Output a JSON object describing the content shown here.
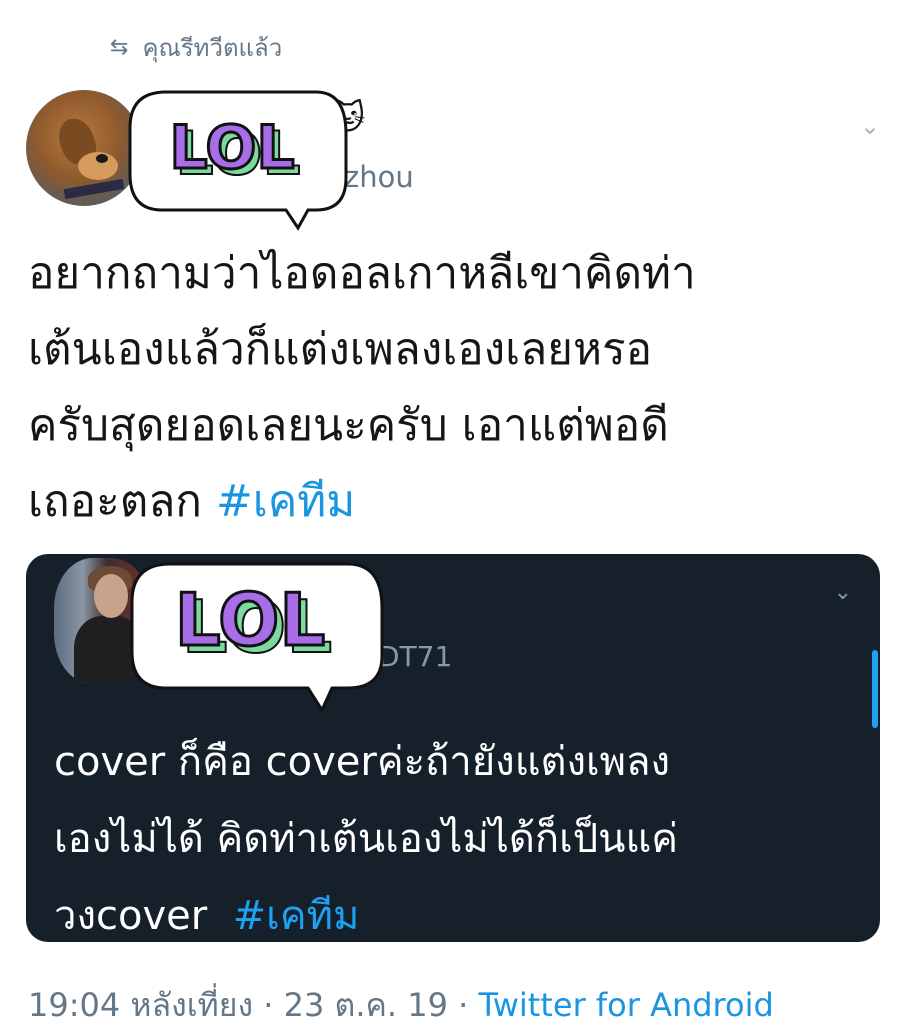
{
  "retweet": {
    "label": "คุณรีทวีตแล้ว"
  },
  "author": {
    "handle_partial": "zhou",
    "emoji": "🐱"
  },
  "stickers": {
    "top": "LOL",
    "quote": "LOL"
  },
  "tweet": {
    "text": "อยากถามว่าไอดอลเกาหลีเขาคิดท่า\nเต้นเองแล้วก็แต่งเพลงเองเลยหรอ\nครับสุดยอดเลยนะครับ เอาแต่พอดี\nเถอะตลก ",
    "hashtag": "#เคทีม"
  },
  "quote": {
    "handle_partial": "DT71",
    "text": "cover ก็คือ coverค่ะถ้ายังแต่งเพลง\nเองไม่ได้ คิดท่าเต้นเองไม่ได้ก็เป็นแค่\nวงcover  ",
    "hashtag": "#เคทีม"
  },
  "meta": {
    "time": "19:04 หลังเที่ยง",
    "sep1": " · ",
    "date": "23 ต.ค. 19",
    "sep2": " · ",
    "source": "Twitter for Android"
  },
  "icons": {
    "retweet": "retweet-icon",
    "caret": "chevron-down-icon"
  },
  "colors": {
    "link": "#1b95e0",
    "quote_bg": "#15202b",
    "muted": "#657786",
    "sticker_purple": "#b07ae6",
    "sticker_green": "#8ee0a8"
  }
}
